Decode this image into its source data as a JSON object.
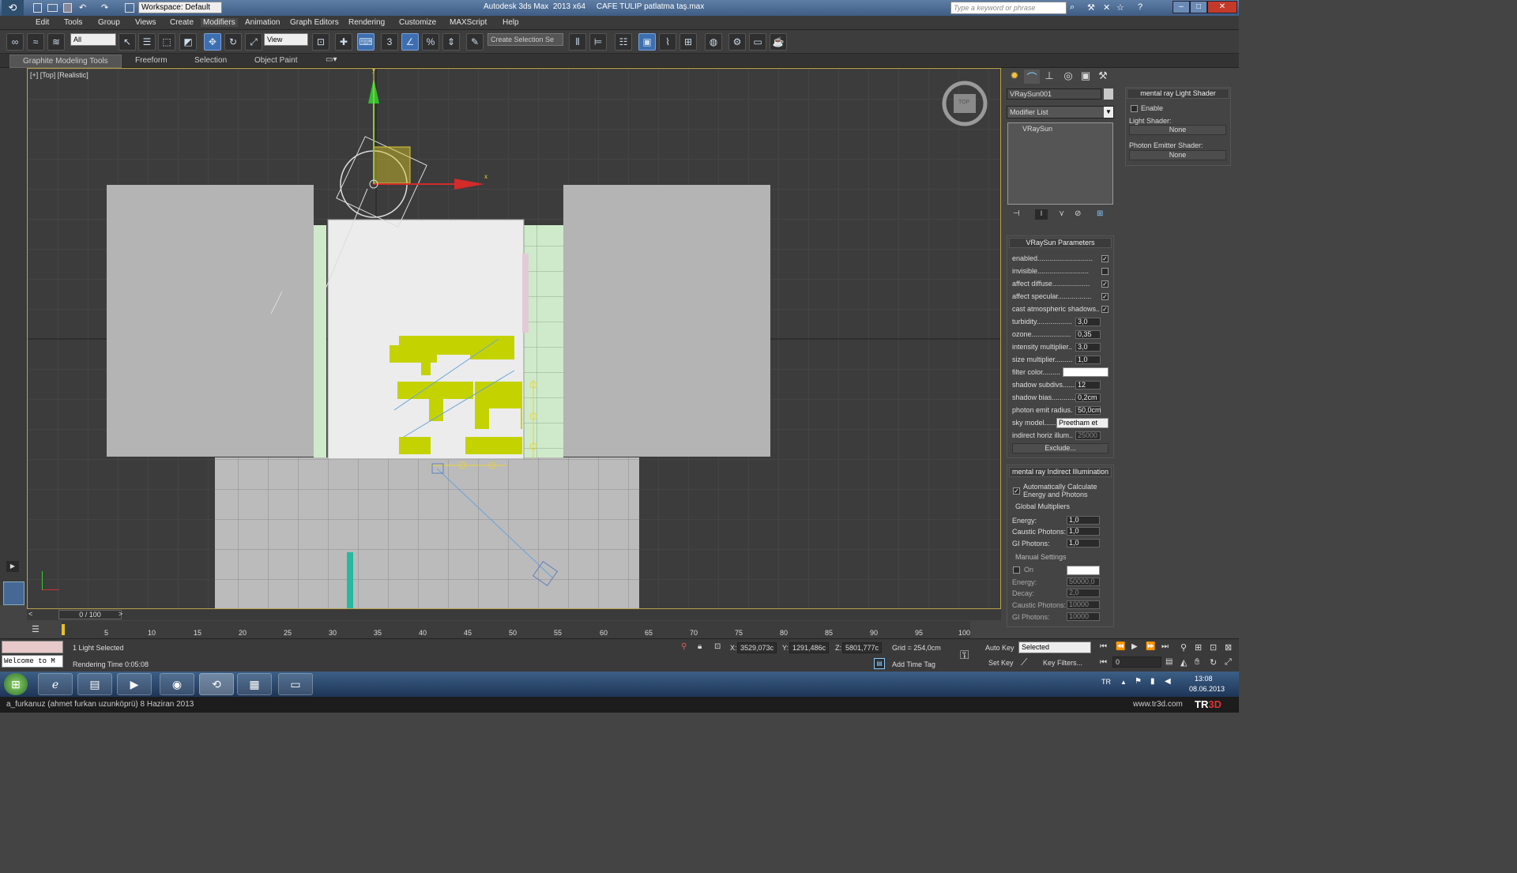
{
  "app": {
    "title": "Autodesk 3ds Max  2013 x64     CAFE TULIP patlatma taş.max",
    "workspace": "Workspace: Default",
    "search_placeholder": "Type a keyword or phrase"
  },
  "menu": [
    "Edit",
    "Tools",
    "Group",
    "Views",
    "Create",
    "Modifiers",
    "Animation",
    "Graph Editors",
    "Rendering",
    "Customize",
    "MAXScript",
    "Help"
  ],
  "toolbar": {
    "selection_filter": "All",
    "ref_coord": "View",
    "named_selection": "Create Selection Se"
  },
  "ribbon": [
    "Graphite Modeling Tools",
    "Freeform",
    "Selection",
    "Object Paint"
  ],
  "viewport": {
    "label": "[+] [Top] [Realistic]",
    "axis_x": "x",
    "axis_y": "y",
    "viewcube": "TOP"
  },
  "command_panel": {
    "object_name": "VRaySun001",
    "modifier_list": "Modifier List",
    "stack_item": "VRaySun",
    "color_swatch": "#c8c8c8"
  },
  "mr_shader": {
    "title": "mental ray Light Shader",
    "enable": "Enable",
    "light_shader_label": "Light Shader:",
    "light_shader_value": "None",
    "photon_label": "Photon Emitter Shader:",
    "photon_value": "None"
  },
  "vraysun": {
    "title": "VRaySun Parameters",
    "params": [
      {
        "label": "enabled............................",
        "check": "✓"
      },
      {
        "label": "invisible..........................",
        "check": ""
      },
      {
        "label": "affect diffuse...................",
        "check": "✓"
      },
      {
        "label": "affect specular.................",
        "check": "✓"
      },
      {
        "label": "cast atmospheric shadows..",
        "check": "✓"
      },
      {
        "label": "turbidity..................",
        "value": "3,0"
      },
      {
        "label": "ozone....................",
        "value": "0,35"
      },
      {
        "label": "intensity multiplier..",
        "value": "3,0"
      },
      {
        "label": "size multiplier.........",
        "value": "1,0"
      },
      {
        "label": "filter color.........",
        "value": ""
      },
      {
        "label": "shadow subdivs.......",
        "value": "12"
      },
      {
        "label": "shadow bias............",
        "value": "0,2cm"
      },
      {
        "label": "photon emit radius.",
        "value": "50,0cm"
      },
      {
        "label": "sky model......",
        "value": "Preetham et"
      },
      {
        "label": "indirect horiz illum..",
        "value": "25000"
      }
    ],
    "exclude": "Exclude..."
  },
  "mr_indirect": {
    "title": "mental ray Indirect Illumination",
    "auto_calc": "Automatically Calculate Energy and Photons",
    "global_title": "Global Multipliers",
    "global": [
      {
        "label": "Energy:",
        "value": "1,0"
      },
      {
        "label": "Caustic Photons:",
        "value": "1,0"
      },
      {
        "label": "GI Photons:",
        "value": "1,0"
      }
    ],
    "manual_title": "Manual Settings",
    "on": "On",
    "manual": [
      {
        "label": "Energy:",
        "value": "50000,0"
      },
      {
        "label": "Decay:",
        "value": "2,0"
      },
      {
        "label": "Caustic Photons:",
        "value": "10000"
      },
      {
        "label": "GI Photons:",
        "value": "10000"
      }
    ]
  },
  "timeline": {
    "frame": "0 / 100",
    "ticks": [
      "5",
      "10",
      "15",
      "20",
      "25",
      "30",
      "35",
      "40",
      "45",
      "50",
      "55",
      "60",
      "65",
      "70",
      "75",
      "80",
      "85",
      "90",
      "95",
      "100"
    ]
  },
  "status": {
    "maxscript": "Welcome to M",
    "selection": "1 Light Selected",
    "render_time": "Rendering Time  0:05:08",
    "x": "3529,073c",
    "y": "1291,486c",
    "z": "5801,777c",
    "grid": "Grid = 254,0cm",
    "add_time_tag": "Add Time Tag",
    "auto_key": "Auto Key",
    "set_key": "Set Key",
    "key_mode": "Selected",
    "key_filters": "Key Filters...",
    "frame_field": "0"
  },
  "taskbar": {
    "lang": "TR",
    "time": "13:08",
    "date": "08.06.2013"
  },
  "footer": {
    "credit": "a_furkanuz (ahmet furkan uzunköprü)  8 Haziran 2013",
    "site": "www.tr3d.com"
  }
}
